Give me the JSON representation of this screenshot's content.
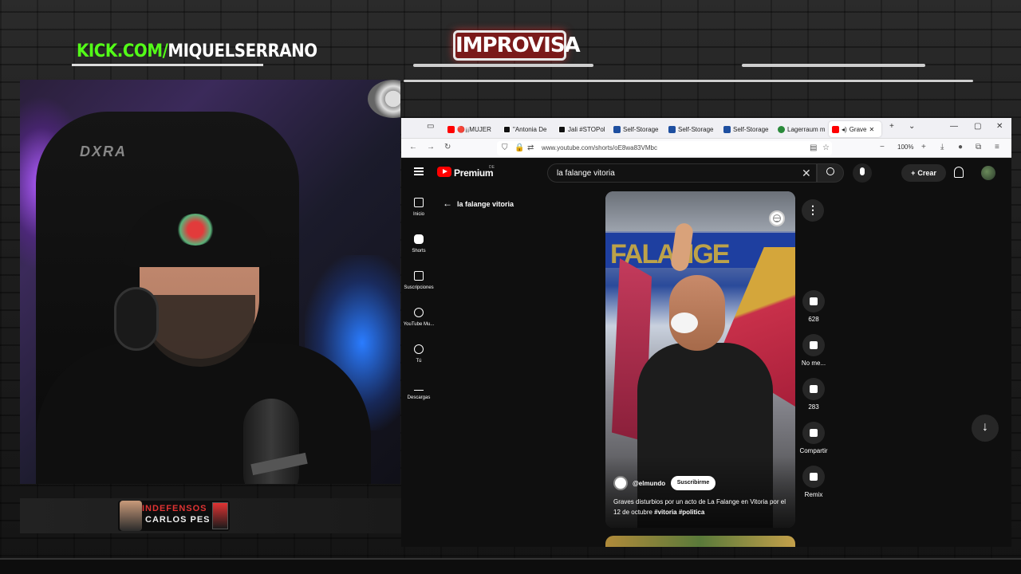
{
  "overlay": {
    "kick_prefix": "KICK.COM/",
    "kick_channel": "MIQUELSERRANO",
    "brand": "IMPROVISA",
    "webcam_chair_brand": "DXRA",
    "banner_title": "INDEFENSOS",
    "banner_subtitle": "CARLOS PES"
  },
  "browser": {
    "tabs": [
      {
        "label": "🔴¡¡MUJER",
        "favicon": "youtube-icon",
        "color": "#ff0000"
      },
      {
        "label": "\"Antonia De",
        "favicon": "x-icon",
        "color": "#111111"
      },
      {
        "label": "Jali #STOPol",
        "favicon": "x-icon",
        "color": "#111111"
      },
      {
        "label": "Self-Storage",
        "favicon": "storage-icon",
        "color": "#1e4fa0"
      },
      {
        "label": "Self-Storage",
        "favicon": "storage-icon",
        "color": "#1e4fa0"
      },
      {
        "label": "Self-Storage",
        "favicon": "storage-icon",
        "color": "#1e4fa0"
      },
      {
        "label": "Lagerraum m",
        "favicon": "storage-icon",
        "color": "#2a8a3a"
      },
      {
        "label": "Grave",
        "favicon": "youtube-icon",
        "color": "#ff0000",
        "active": true
      }
    ],
    "url": "www.youtube.com/shorts/oE8wa83VMbc",
    "zoom": "100%"
  },
  "youtube": {
    "brand": "Premium",
    "region": "DE",
    "search_value": "la falange vitoria",
    "create_label": "Crear",
    "sidebar": [
      {
        "label": "Inicio",
        "icon": "home-icon"
      },
      {
        "label": "Shorts",
        "icon": "shorts-icon"
      },
      {
        "label": "Suscripciones",
        "icon": "subscriptions-icon"
      },
      {
        "label": "YouTube Mu...",
        "icon": "youtube-music-icon"
      },
      {
        "label": "Tú",
        "icon": "you-icon"
      },
      {
        "label": "Descargas",
        "icon": "downloads-icon"
      }
    ],
    "back_label": "la falange vitoria",
    "short": {
      "channel": "@elmundo",
      "subscribe_label": "Suscribirme",
      "caption": "Graves disturbios por un acto de La Falange en Vitoria por el 12 de octubre ",
      "hashtags": "#vitoria #politica",
      "banner_text": "FALANGE"
    },
    "actions": {
      "likes": "628",
      "dislike_label": "No me...",
      "comments": "283",
      "share_label": "Compartir",
      "remix_label": "Remix"
    }
  }
}
